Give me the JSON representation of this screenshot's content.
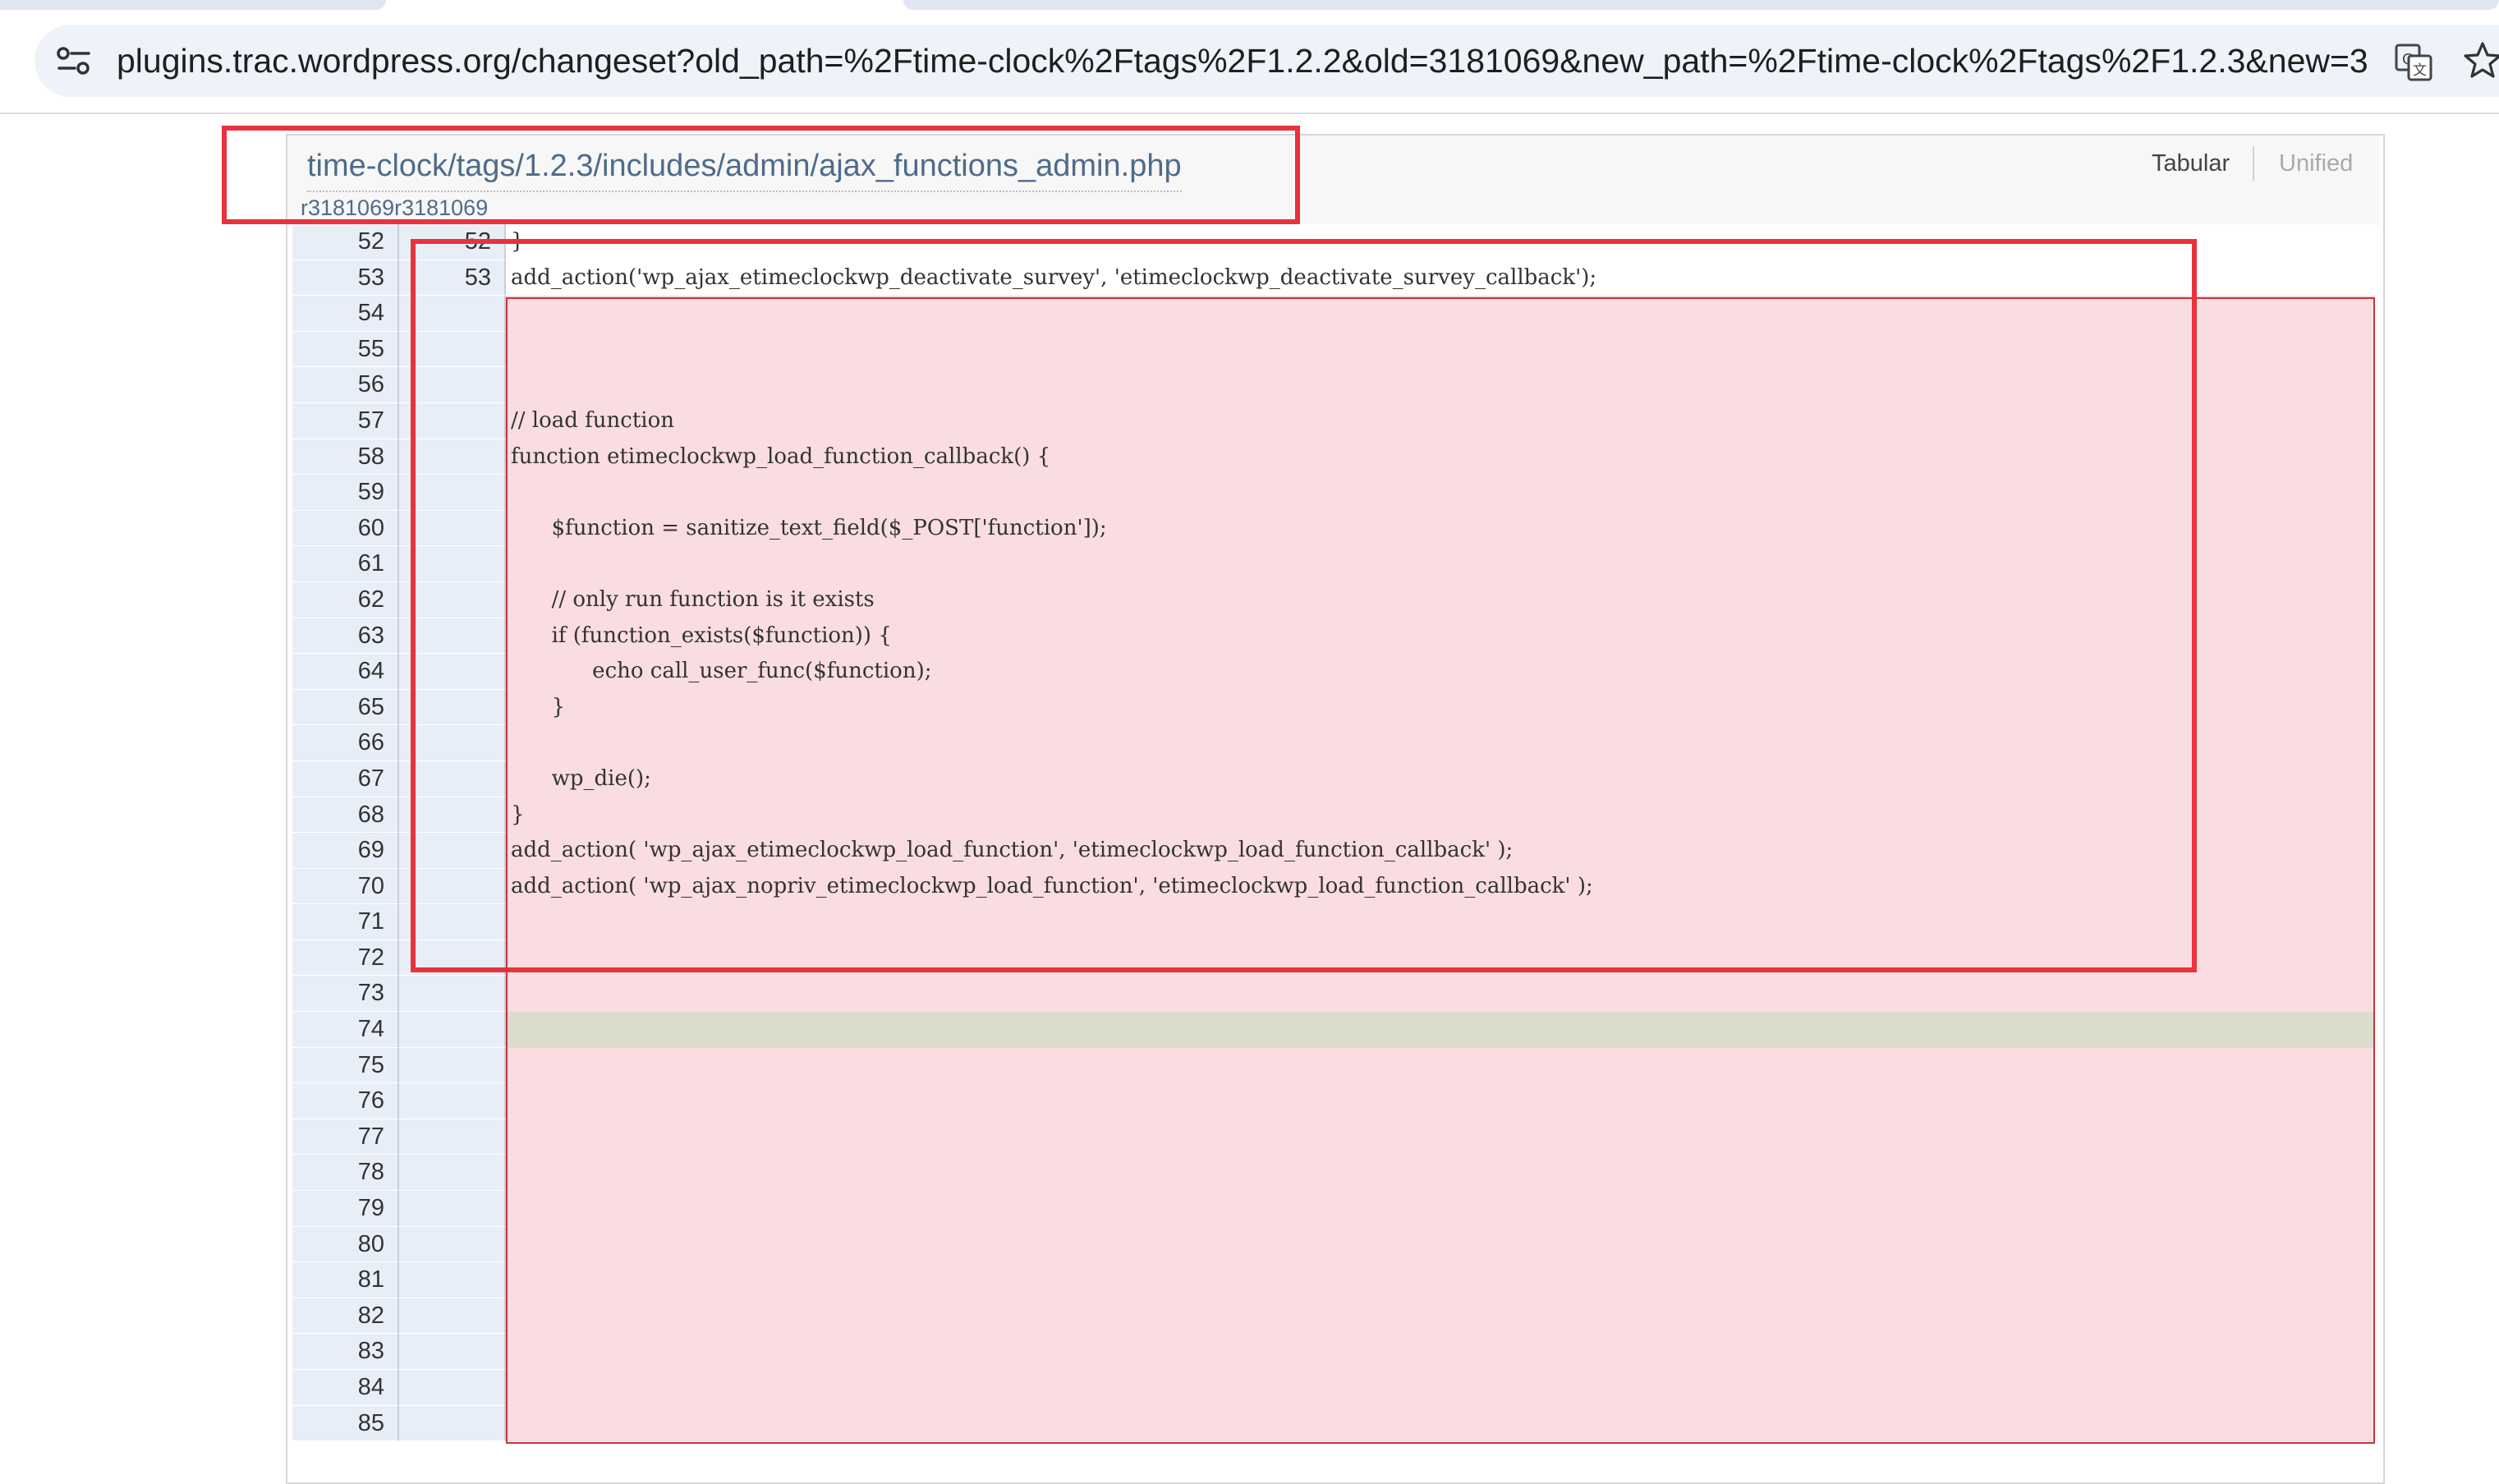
{
  "browser": {
    "url": "plugins.trac.wordpress.org/changeset?old_path=%2Ftime-clock%2Ftags%2F1.2.2&old=3181069&new_path=%2Ftime-clock%2Ftags%2F1.2.3&new=3...",
    "icons": [
      "site-info-icon",
      "translate-icon",
      "bookmark-star-icon"
    ]
  },
  "diff": {
    "file_path": "time-clock/tags/1.2.3/includes/admin/ajax_functions_admin.php",
    "revisions": "r3181069r3181069",
    "view_tabular": "Tabular",
    "view_unified": "Unified",
    "colors": {
      "deleted_bg": "#f9dde0",
      "modified_bg": "#dcdccc",
      "line_number_bg": "#e8eef8",
      "annotation_red": "#e8323d"
    },
    "rows": [
      {
        "old": "52",
        "new": "52",
        "code": "}",
        "type": "ctx"
      },
      {
        "old": "53",
        "new": "53",
        "code": "add_action('wp_ajax_etimeclockwp_deactivate_survey', 'etimeclockwp_deactivate_survey_callback');",
        "type": "ctx"
      },
      {
        "old": "54",
        "new": "",
        "code": "",
        "type": "del"
      },
      {
        "old": "55",
        "new": "",
        "code": "",
        "type": "del"
      },
      {
        "old": "56",
        "new": "",
        "code": "",
        "type": "del"
      },
      {
        "old": "57",
        "new": "",
        "code": "// load function",
        "type": "del"
      },
      {
        "old": "58",
        "new": "",
        "code": "function etimeclockwp_load_function_callback() {",
        "type": "del"
      },
      {
        "old": "59",
        "new": "",
        "code": "",
        "type": "del"
      },
      {
        "old": "60",
        "new": "",
        "code": "      $function = sanitize_text_field($_POST['function']);",
        "type": "del"
      },
      {
        "old": "61",
        "new": "",
        "code": "",
        "type": "del"
      },
      {
        "old": "62",
        "new": "",
        "code": "      // only run function is it exists",
        "type": "del"
      },
      {
        "old": "63",
        "new": "",
        "code": "      if (function_exists($function)) {",
        "type": "del"
      },
      {
        "old": "64",
        "new": "",
        "code": "            echo call_user_func($function);",
        "type": "del"
      },
      {
        "old": "65",
        "new": "",
        "code": "      }",
        "type": "del"
      },
      {
        "old": "66",
        "new": "",
        "code": "",
        "type": "del"
      },
      {
        "old": "67",
        "new": "",
        "code": "      wp_die();",
        "type": "del"
      },
      {
        "old": "68",
        "new": "",
        "code": "}",
        "type": "del"
      },
      {
        "old": "69",
        "new": "",
        "code": "add_action( 'wp_ajax_etimeclockwp_load_function', 'etimeclockwp_load_function_callback' );",
        "type": "del"
      },
      {
        "old": "70",
        "new": "",
        "code": "add_action( 'wp_ajax_nopriv_etimeclockwp_load_function', 'etimeclockwp_load_function_callback' );",
        "type": "del"
      },
      {
        "old": "71",
        "new": "",
        "code": "",
        "type": "del"
      },
      {
        "old": "72",
        "new": "",
        "code": "",
        "type": "del"
      },
      {
        "old": "73",
        "new": "",
        "code": "",
        "type": "del"
      },
      {
        "old": "74",
        "new": "",
        "code": "",
        "type": "mod"
      },
      {
        "old": "75",
        "new": "",
        "code": "",
        "type": "del"
      },
      {
        "old": "76",
        "new": "",
        "code": "",
        "type": "del"
      },
      {
        "old": "77",
        "new": "",
        "code": "",
        "type": "del"
      },
      {
        "old": "78",
        "new": "",
        "code": "",
        "type": "del"
      },
      {
        "old": "79",
        "new": "",
        "code": "",
        "type": "del"
      },
      {
        "old": "80",
        "new": "",
        "code": "",
        "type": "del"
      },
      {
        "old": "81",
        "new": "",
        "code": "",
        "type": "del"
      },
      {
        "old": "82",
        "new": "",
        "code": "",
        "type": "del"
      },
      {
        "old": "83",
        "new": "",
        "code": "",
        "type": "del"
      },
      {
        "old": "84",
        "new": "",
        "code": "",
        "type": "del"
      },
      {
        "old": "85",
        "new": "",
        "code": "",
        "type": "del"
      }
    ]
  }
}
